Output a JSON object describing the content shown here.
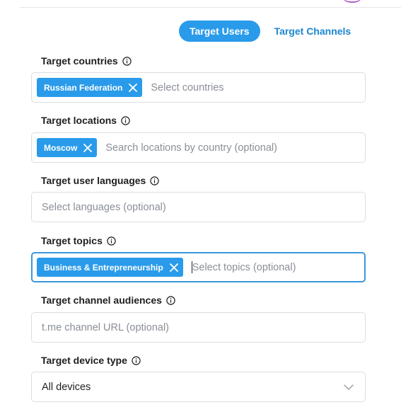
{
  "tabs": {
    "active_label": "Target Users",
    "inactive_label": "Target Channels"
  },
  "fields": {
    "countries": {
      "label": "Target countries",
      "chip": "Russian Federation",
      "placeholder": "Select countries"
    },
    "locations": {
      "label": "Target locations",
      "chip": "Moscow",
      "placeholder": "Search locations by country (optional)"
    },
    "languages": {
      "label": "Target user languages",
      "placeholder": "Select languages (optional)"
    },
    "topics": {
      "label": "Target topics",
      "chip": "Business & Entrepreneurship",
      "placeholder": "Select topics (optional)"
    },
    "channel_audiences": {
      "label": "Target channel audiences",
      "placeholder": "t.me channel URL (optional)"
    },
    "device_type": {
      "label": "Target device type",
      "value": "All devices"
    }
  },
  "icons": {
    "info": "info-circle-icon",
    "chip_remove": "close-icon",
    "dropdown": "chevron-down-icon"
  },
  "colors": {
    "accent": "#2a9bea",
    "link": "#1c86d0",
    "focus_border": "#3a98dd",
    "placeholder": "#8a8f96"
  }
}
